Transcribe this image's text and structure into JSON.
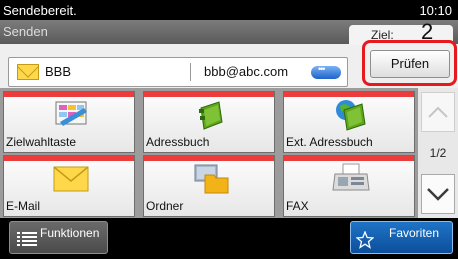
{
  "status": {
    "message": "Sendebereit.",
    "time": "10:10"
  },
  "header": {
    "title": "Senden",
    "destination_label": "Ziel:",
    "destination_count": "2"
  },
  "destination": {
    "name": "BBB",
    "email": "bbb@abc.com",
    "check_button": "Prüfen"
  },
  "tiles": [
    {
      "label": "Zielwahltaste",
      "icon": "one-touch-key-icon"
    },
    {
      "label": "Adressbuch",
      "icon": "address-book-icon"
    },
    {
      "label": "Ext. Adressbuch",
      "icon": "external-address-book-icon"
    },
    {
      "label": "E-Mail",
      "icon": "email-icon"
    },
    {
      "label": "Ordner",
      "icon": "folder-icon"
    },
    {
      "label": "FAX",
      "icon": "fax-icon"
    }
  ],
  "pagination": {
    "page": "1/2"
  },
  "footer": {
    "functions_label": "Funktionen",
    "favorites_label": "Favoriten"
  },
  "colors": {
    "tile_accent": "#ec3c3c",
    "highlight": "#e7191d",
    "favorites_blue": "#1f73c6"
  }
}
